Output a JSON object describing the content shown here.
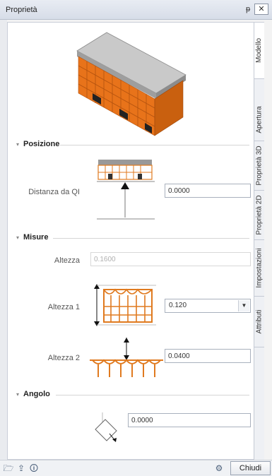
{
  "window": {
    "title": "Proprietà",
    "pin_glyph": "ᵽ",
    "close_glyph": "✕"
  },
  "tabs": [
    {
      "label": "Modello",
      "active": true
    },
    {
      "label": "Apertura",
      "active": false
    },
    {
      "label": "Proprietà 3D",
      "active": false
    },
    {
      "label": "Proprietà 2D",
      "active": false
    },
    {
      "label": "Impostazioni",
      "active": false
    },
    {
      "label": "Attributi",
      "active": false
    }
  ],
  "sections": {
    "posizione": {
      "title": "Posizione",
      "distanza_label": "Distanza da QI",
      "distanza_value": "0.0000"
    },
    "misure": {
      "title": "Misure",
      "altezza_label": "Altezza",
      "altezza_value": "0.1600",
      "altezza1_label": "Altezza 1",
      "altezza1_value": "0.120",
      "altezza2_label": "Altezza 2",
      "altezza2_value": "0.0400"
    },
    "angolo": {
      "title": "Angolo",
      "angolo_value": "0.0000"
    }
  },
  "bottombar": {
    "close_label": "Chiudi"
  },
  "colors": {
    "accent_orange": "#e07a1f",
    "titlebar": "#dde2ea"
  }
}
